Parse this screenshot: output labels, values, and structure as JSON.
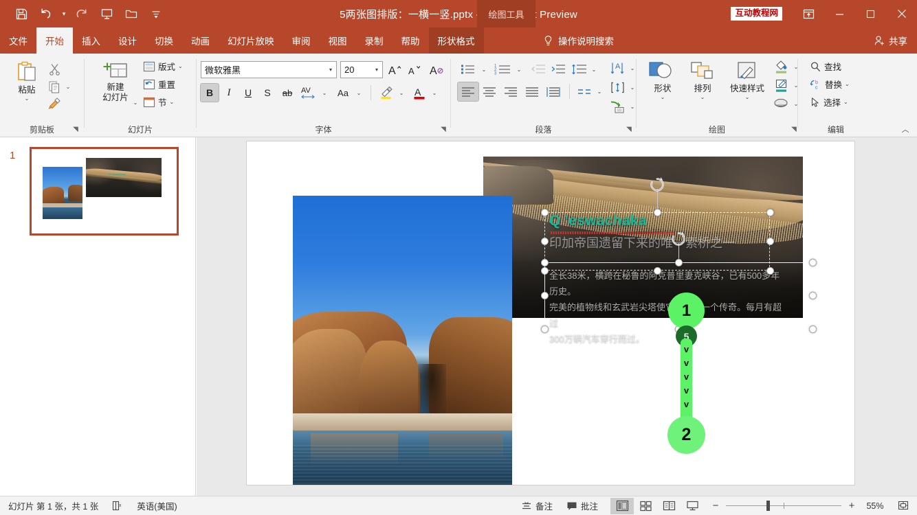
{
  "titlebar": {
    "document_title": "5两张图排版：一横一竖.pptx  -  PowerPoint Preview",
    "contextual_tab_header": "绘图工具",
    "watermark_badge": "互动教程网",
    "qat": [
      {
        "name": "save",
        "icon": "save-icon"
      },
      {
        "name": "undo",
        "icon": "undo-icon"
      },
      {
        "name": "redo",
        "icon": "redo-icon"
      },
      {
        "name": "start-slideshow",
        "icon": "slideshow-icon"
      },
      {
        "name": "open",
        "icon": "folder-icon"
      },
      {
        "name": "customize-qat",
        "icon": "chevron-down-icon"
      }
    ],
    "window_controls": [
      {
        "name": "ribbon-display-options",
        "icon": "ribbon-options-icon"
      },
      {
        "name": "minimize",
        "icon": "minimize-icon"
      },
      {
        "name": "restore",
        "icon": "restore-icon"
      },
      {
        "name": "close",
        "icon": "close-icon"
      }
    ]
  },
  "tabs": [
    {
      "label": "文件",
      "active": false,
      "ctx": false
    },
    {
      "label": "开始",
      "active": true,
      "ctx": false
    },
    {
      "label": "插入",
      "active": false,
      "ctx": false
    },
    {
      "label": "设计",
      "active": false,
      "ctx": false
    },
    {
      "label": "切换",
      "active": false,
      "ctx": false
    },
    {
      "label": "动画",
      "active": false,
      "ctx": false
    },
    {
      "label": "幻灯片放映",
      "active": false,
      "ctx": false
    },
    {
      "label": "审阅",
      "active": false,
      "ctx": false
    },
    {
      "label": "视图",
      "active": false,
      "ctx": false
    },
    {
      "label": "录制",
      "active": false,
      "ctx": false
    },
    {
      "label": "帮助",
      "active": false,
      "ctx": false
    },
    {
      "label": "形状格式",
      "active": false,
      "ctx": true
    }
  ],
  "tell_me": "操作说明搜索",
  "share": "共享",
  "ribbon": {
    "groups": [
      {
        "name": "clipboard",
        "label": "剪贴板"
      },
      {
        "name": "slides",
        "label": "幻灯片"
      },
      {
        "name": "font",
        "label": "字体"
      },
      {
        "name": "paragraph",
        "label": "段落"
      },
      {
        "name": "drawing",
        "label": "绘图"
      },
      {
        "name": "editing",
        "label": "编辑"
      }
    ],
    "clipboard": {
      "paste": "粘贴",
      "cut_name": "cut-icon",
      "copy_name": "copy-icon",
      "format_painter_name": "format-painter-icon"
    },
    "slides": {
      "new_slide": "新建\n幻灯片",
      "new_slide_l1": "新建",
      "new_slide_l2": "幻灯片",
      "layout": "版式",
      "reset": "重置",
      "section": "节"
    },
    "font": {
      "font_family": "微软雅黑",
      "font_size": "20",
      "grow_font": "A",
      "shrink_font": "A",
      "clear_formatting": "清除所有格式",
      "bold": "B",
      "italic": "I",
      "underline": "U",
      "shadow": "S",
      "strikethrough": "ab",
      "character_spacing": "AV",
      "change_case": "Aa",
      "highlight": "文本突出显示颜色",
      "font_color": "A"
    },
    "paragraph": {
      "bullets": "项目符号",
      "numbering": "编号",
      "decrease_indent": "减少缩进量",
      "increase_indent": "增加缩进量",
      "line_spacing": "行距",
      "align_left": "左对齐",
      "align_center": "居中",
      "align_right": "右对齐",
      "justify": "两端对齐",
      "distributed": "分散对齐",
      "columns": "分栏",
      "text_direction": "文字方向",
      "align_text": "对齐文本",
      "smartart": "转换为 SmartArt"
    },
    "drawing": {
      "shapes": "形状",
      "arrange": "排列",
      "quick_styles": "快速样式",
      "shape_fill": "形状填充",
      "shape_outline": "形状轮廓",
      "shape_effects": "形状效果"
    },
    "editing": {
      "find": "查找",
      "replace": "替换",
      "select": "选择"
    }
  },
  "thumbnails": [
    {
      "number": "1",
      "selected": true
    }
  ],
  "slide": {
    "title": "Q 'eswachaka",
    "subtitle": "印加帝国遗留下来的唯一索桥之一",
    "body_line1": "全长38米，横跨在秘鲁的阿克普里妻克峡谷，已有500多年历史。",
    "body_line2": "完美的植物线和玄武岩尖塔使它成为了一个传奇。每月有超过",
    "body_line3": "300万辆汽车穿行而过。",
    "title_color": "#18b79a",
    "images": [
      {
        "name": "canyon-river-vertical-photo"
      },
      {
        "name": "rope-bridge-horizontal-photo"
      }
    ]
  },
  "annotation": {
    "marker_1": "1",
    "marker_5": "5",
    "marker_2": "2",
    "chevron": "v",
    "chevron_count": 5,
    "color": "#5cf266",
    "badge_color": "#1d6b2b"
  },
  "status": {
    "slide_count": "幻灯片 第 1 张，共 1 张",
    "accessibility_name": "accessibility-checker-icon",
    "language": "英语(美国)",
    "notes": "备注",
    "comments": "批注",
    "views": [
      {
        "name": "normal-view",
        "active": true
      },
      {
        "name": "slide-sorter-view",
        "active": false
      },
      {
        "name": "reading-view",
        "active": false
      },
      {
        "name": "slideshow-view",
        "active": false
      }
    ],
    "zoom_out": "−",
    "zoom_in": "+",
    "zoom_level": "55%",
    "fit_slide_name": "fit-to-window-icon"
  }
}
